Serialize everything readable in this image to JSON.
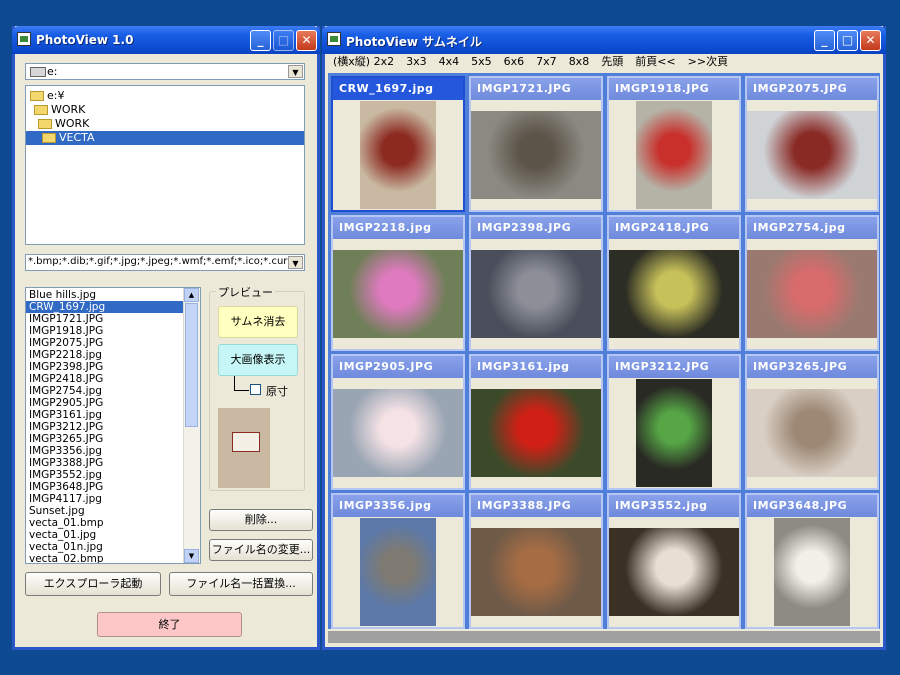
{
  "left_window": {
    "title": "PhotoView 1.0",
    "drive": "e:",
    "tree": [
      "e:¥",
      "WORK",
      "WORK",
      "VECTA"
    ],
    "filter": "*.bmp;*.dib;*.gif;*.jpg;*.jpeg;*.wmf;*.emf;*.ico;*.cur",
    "files": [
      "Blue hills.jpg",
      "CRW_1697.jpg",
      "IMGP1721.JPG",
      "IMGP1918.JPG",
      "IMGP2075.JPG",
      "IMGP2218.jpg",
      "IMGP2398.JPG",
      "IMGP2418.JPG",
      "IMGP2754.jpg",
      "IMGP2905.JPG",
      "IMGP3161.jpg",
      "IMGP3212.JPG",
      "IMGP3265.JPG",
      "IMGP3356.jpg",
      "IMGP3388.JPG",
      "IMGP3552.jpg",
      "IMGP3648.JPG",
      "IMGP4117.jpg",
      "Sunset.jpg",
      "vecta_01.bmp",
      "vecta_01.jpg",
      "vecta_01n.jpg",
      "vecta_02.bmp"
    ],
    "selected_file": "CRW_1697.jpg",
    "preview_group": "プレビュー",
    "btn_clear_thumbs": "サムネ消去",
    "btn_large_view": "大画像表示",
    "chk_original": "原寸",
    "btn_delete": "削除...",
    "btn_rename": "ファイル名の変更...",
    "btn_explorer": "エクスプローラ起動",
    "btn_batch_rename": "ファイル名一括置換...",
    "btn_exit": "終了"
  },
  "right_window": {
    "title": "PhotoView サムネイル",
    "toolbar": [
      "(横x縦) 2x2",
      "3x3",
      "4x4",
      "5x5",
      "6x6",
      "7x7",
      "8x8",
      "先頭",
      "前頁<<",
      ">>次頁"
    ],
    "thumbs": [
      {
        "name": "CRW_1697.jpg",
        "bg": "#c9b9a2",
        "fg": "#8c2a20"
      },
      {
        "name": "IMGP1721.JPG",
        "bg": "#8a8a82",
        "fg": "#5e554a"
      },
      {
        "name": "IMGP1918.JPG",
        "bg": "#b5b2a6",
        "fg": "#c9302c"
      },
      {
        "name": "IMGP2075.JPG",
        "bg": "#cfd3d6",
        "fg": "#8a2a25"
      },
      {
        "name": "IMGP2218.jpg",
        "bg": "#6f7f58",
        "fg": "#e07ac0"
      },
      {
        "name": "IMGP2398.JPG",
        "bg": "#4a4e5a",
        "fg": "#8c8f98"
      },
      {
        "name": "IMGP2418.JPG",
        "bg": "#2c2d24",
        "fg": "#c7c15a"
      },
      {
        "name": "IMGP2754.jpg",
        "bg": "#9a7a70",
        "fg": "#d86b6b"
      },
      {
        "name": "IMGP2905.JPG",
        "bg": "#9aa5b3",
        "fg": "#f4e2e5"
      },
      {
        "name": "IMGP3161.jpg",
        "bg": "#3d4a2a",
        "fg": "#d02015"
      },
      {
        "name": "IMGP3212.JPG",
        "bg": "#2a2a24",
        "fg": "#56a646"
      },
      {
        "name": "IMGP3265.JPG",
        "bg": "#d9cfc4",
        "fg": "#9c8874"
      },
      {
        "name": "IMGP3356.jpg",
        "bg": "#5c79a9",
        "fg": "#7e7a72"
      },
      {
        "name": "IMGP3388.JPG",
        "bg": "#6f5a48",
        "fg": "#a66d44"
      },
      {
        "name": "IMGP3552.jpg",
        "bg": "#3a3024",
        "fg": "#e8dfd2"
      },
      {
        "name": "IMGP3648.JPG",
        "bg": "#8c8c82",
        "fg": "#f3f0ea"
      }
    ]
  }
}
